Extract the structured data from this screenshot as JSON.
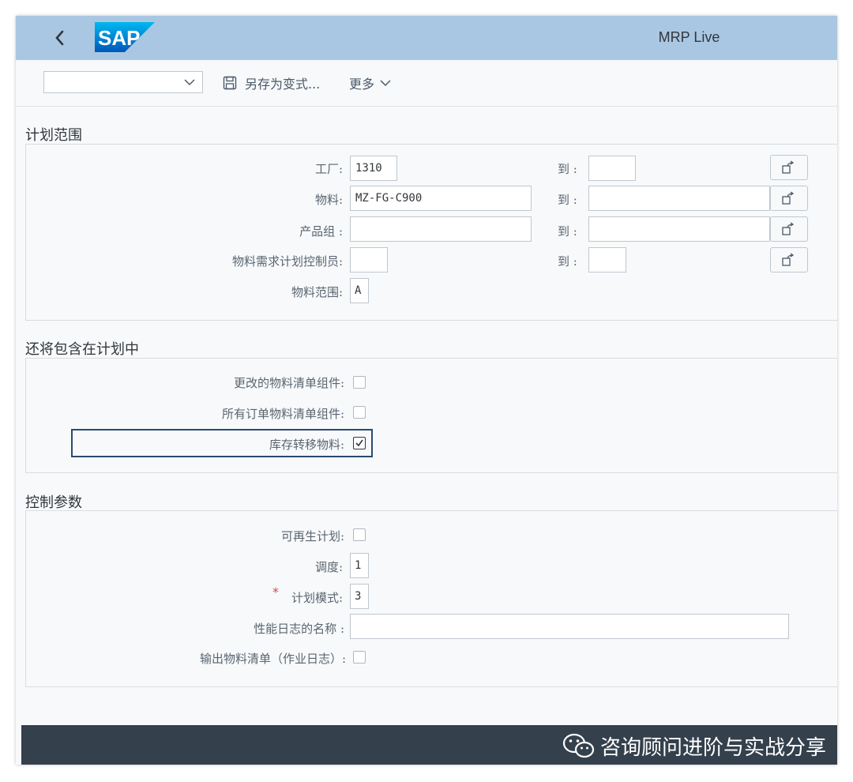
{
  "header": {
    "back_icon": "chevron-left-icon",
    "logo_text": "SAP",
    "app_title": "MRP Live"
  },
  "toolbar": {
    "variant_value": "",
    "save_variant_label": "另存为变式...",
    "save_icon": "floppy-disk-icon",
    "more_label": "更多",
    "more_icon": "chevron-down-icon"
  },
  "planning_scope": {
    "title": "计划范围",
    "to_label": "到 :",
    "rows": [
      {
        "label": "工厂:",
        "value": "1310",
        "to_value": ""
      },
      {
        "label": "物料:",
        "value": "MZ-FG-C900",
        "to_value": ""
      },
      {
        "label": "产品组 :",
        "value": "",
        "to_value": ""
      },
      {
        "label": "物料需求计划控制员:",
        "value": "",
        "to_value": ""
      }
    ],
    "material_scope": {
      "label": "物料范围:",
      "value": "A"
    }
  },
  "also_include": {
    "title": "还将包含在计划中",
    "items": [
      {
        "label": "更改的物料清单组件:",
        "checked": false
      },
      {
        "label": "所有订单物料清单组件:",
        "checked": false
      },
      {
        "label": "库存转移物料:",
        "checked": true
      }
    ]
  },
  "control_params": {
    "title": "控制参数",
    "regenerative": {
      "label": "可再生计划:",
      "checked": false
    },
    "scheduling": {
      "label": "调度:",
      "value": "1"
    },
    "planning_mode": {
      "label": "计划模式:",
      "value": "3",
      "required_mark": "*"
    },
    "perf_log": {
      "label": "性能日志的名称 :",
      "value": ""
    },
    "output_bom": {
      "label": "输出物料清单（作业日志）:",
      "checked": false
    }
  },
  "watermark": {
    "icon": "wechat-icon",
    "text": "咨询顾问进阶与实战分享"
  },
  "colors": {
    "shell_bg": "#a9c7e2",
    "page_bg": "#f7f9fb",
    "footer_bg": "#34404c",
    "focus_border": "#2b4a6f",
    "required": "#e34352"
  }
}
